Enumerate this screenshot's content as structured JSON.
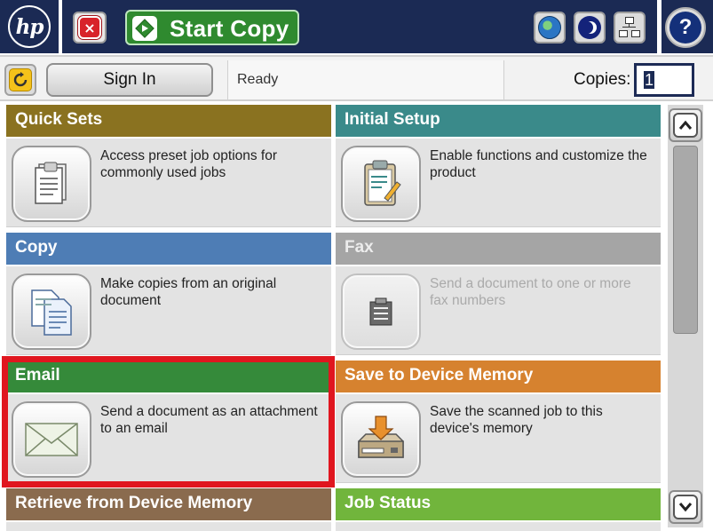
{
  "topbar": {
    "logo_text": "hp",
    "stop_label": "×",
    "start_label": "Start Copy",
    "help_label": "?"
  },
  "statusbar": {
    "signin_label": "Sign In",
    "status_text": "Ready",
    "copies_label": "Copies:",
    "copies_value": "1"
  },
  "tiles": [
    {
      "title": "Quick Sets",
      "description": "Access preset job options for commonly used jobs",
      "color": "#8a7220",
      "enabled": true,
      "icon": "clipboard-stack-icon"
    },
    {
      "title": "Initial Setup",
      "description": "Enable functions and customize the product",
      "color": "#3a8a8a",
      "enabled": true,
      "icon": "clipboard-pencil-icon"
    },
    {
      "title": "Copy",
      "description": "Make copies from an original document",
      "color": "#4e7db5",
      "enabled": true,
      "icon": "copy-documents-icon"
    },
    {
      "title": "Fax",
      "description": "Send a document to one or more fax numbers",
      "color": "#a5a5a5",
      "enabled": false,
      "icon": "fax-icon"
    },
    {
      "title": "Email",
      "description": "Send a document as an attachment to an email",
      "color": "#358a3a",
      "enabled": true,
      "icon": "envelope-icon"
    },
    {
      "title": "Save to Device Memory",
      "description": "Save the scanned job to this device's memory",
      "color": "#d6822f",
      "enabled": true,
      "icon": "save-to-device-icon"
    },
    {
      "title": "Retrieve from Device Memory",
      "description": "",
      "color": "#8a6b4e",
      "enabled": true,
      "icon": ""
    },
    {
      "title": "Job Status",
      "description": "",
      "color": "#71b53c",
      "enabled": true,
      "icon": ""
    }
  ],
  "colors": {
    "header_bar": "#1b2a54",
    "highlight": "#e0161f",
    "start_green": "#2f8a2f",
    "stop_red": "#d8232a"
  }
}
